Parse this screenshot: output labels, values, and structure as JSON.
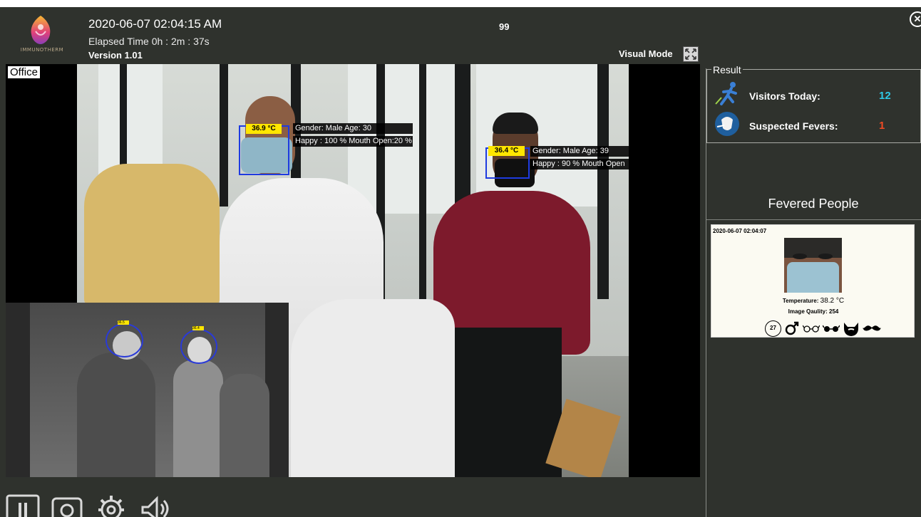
{
  "app": {
    "logo_text": "IMMUNOTHERM",
    "datetime": "2020-06-07 02:04:15 AM",
    "elapsed": "Elapsed Time 0h : 2m : 37s",
    "version": "Version 1.01",
    "counter": "99",
    "visual_mode_label": "Visual Mode",
    "close_icon": "close-icon"
  },
  "camera": {
    "location_label": "Office",
    "detections": [
      {
        "temperature": "36.9 °C",
        "line1": "Gender: Male Age: 30",
        "line2": "Happy : 100 % Mouth Open:20 %"
      },
      {
        "temperature": "36.4 °C",
        "line1": "Gender: Male Age: 39",
        "line2": "Happy : 90 % Mouth Open"
      }
    ],
    "thermal_tags": [
      "36.5",
      "36.4"
    ]
  },
  "result": {
    "legend": "Result",
    "visitors_label": "Visitors Today:",
    "visitors_value": "12",
    "visitors_color": "#2ec8e6",
    "fevers_label": "Suspected Fevers:",
    "fevers_value": "1",
    "fevers_color": "#f04a23"
  },
  "fevered": {
    "title": "Fevered People",
    "cards": [
      {
        "time": "2020-06-07 02:04:07",
        "temperature_label": "Temperature:",
        "temperature_value": "38.2 °C",
        "quality_label": "Image Qaulity:",
        "quality_value": "254",
        "age": "27",
        "icons": [
          "age-icon",
          "male-icon",
          "glasses-icon",
          "sunglasses-icon",
          "beard-icon",
          "mustache-icon"
        ]
      }
    ]
  },
  "toolbar": {
    "icons": [
      "pause-icon",
      "camera-icon",
      "settings-icon",
      "speaker-icon"
    ]
  }
}
